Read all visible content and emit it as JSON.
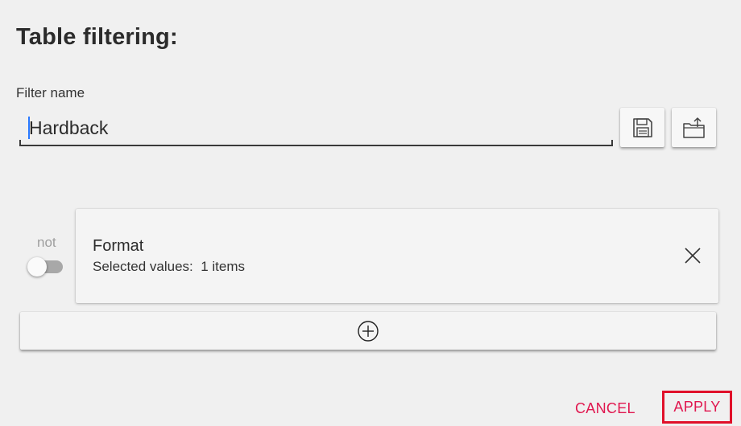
{
  "dialog": {
    "title": "Table filtering:",
    "filter_name_label": "Filter name",
    "filter_name_value": "Hardback"
  },
  "toolbar": {
    "save_icon": "floppy-disk-icon",
    "share_icon": "export-folder-icon"
  },
  "filter": {
    "not_label": "not",
    "not_toggle_on": false,
    "field_name": "Format",
    "selected_values_text": "Selected values:  1 items",
    "remove_icon": "close-icon"
  },
  "add_filter": {
    "icon": "add-circle-icon"
  },
  "actions": {
    "cancel_label": "CANCEL",
    "apply_label": "APPLY"
  },
  "colors": {
    "accent": "#e0174f",
    "highlight_border": "#e0102a",
    "caret": "#2979ff"
  }
}
